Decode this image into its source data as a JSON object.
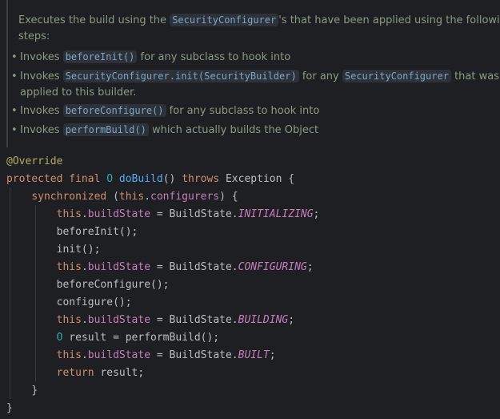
{
  "javadoc": {
    "intro_prefix": "Executes the build using the",
    "intro_code": "SecurityConfigurer",
    "intro_suffix_line1": "'s that have been applied using the following",
    "intro_line2": "steps:",
    "bullets": [
      {
        "prefix": "Invokes",
        "code": "beforeInit()",
        "suffix": "for any subclass to hook into"
      },
      {
        "prefix": "Invokes",
        "code": "SecurityConfigurer.init(SecurityBuilder)",
        "middle": "for any",
        "code2": "SecurityConfigurer",
        "suffix": "that was",
        "continuation": "applied to this builder."
      },
      {
        "prefix": "Invokes",
        "code": "beforeConfigure()",
        "suffix": "for any subclass to hook into"
      },
      {
        "prefix": "Invokes",
        "code": "performBuild()",
        "suffix": "which actually builds the Object"
      }
    ],
    "bullet_glyph": "•"
  },
  "code": {
    "annotation": "@Override",
    "sig": {
      "kw_protected": "protected",
      "kw_final": "final",
      "type_param": "O",
      "method": "doBuild",
      "parens": "()",
      "kw_throws": "throws",
      "exception": "Exception",
      "open_brace": "{"
    },
    "sync": {
      "kw": "synchronized",
      "open": "(",
      "this": "this",
      "dot": ".",
      "field": "configurers",
      "close": ") {"
    },
    "body": {
      "this": "this",
      "dot": ".",
      "field_buildState": "buildState",
      "assign": " = BuildState.",
      "semi": ";",
      "c_initializing": "INITIALIZING",
      "c_configuring": "CONFIGURING",
      "c_building": "BUILDING",
      "c_built": "BUILT",
      "call_beforeInit": "beforeInit();",
      "call_init": "init();",
      "call_beforeConfigure": "beforeConfigure();",
      "call_configure": "configure();",
      "result_type": "O",
      "result_decl": " result = performBuild();",
      "kw_return": "return",
      "return_rest": " result;"
    },
    "close_inner": "}",
    "close_outer": "}"
  }
}
